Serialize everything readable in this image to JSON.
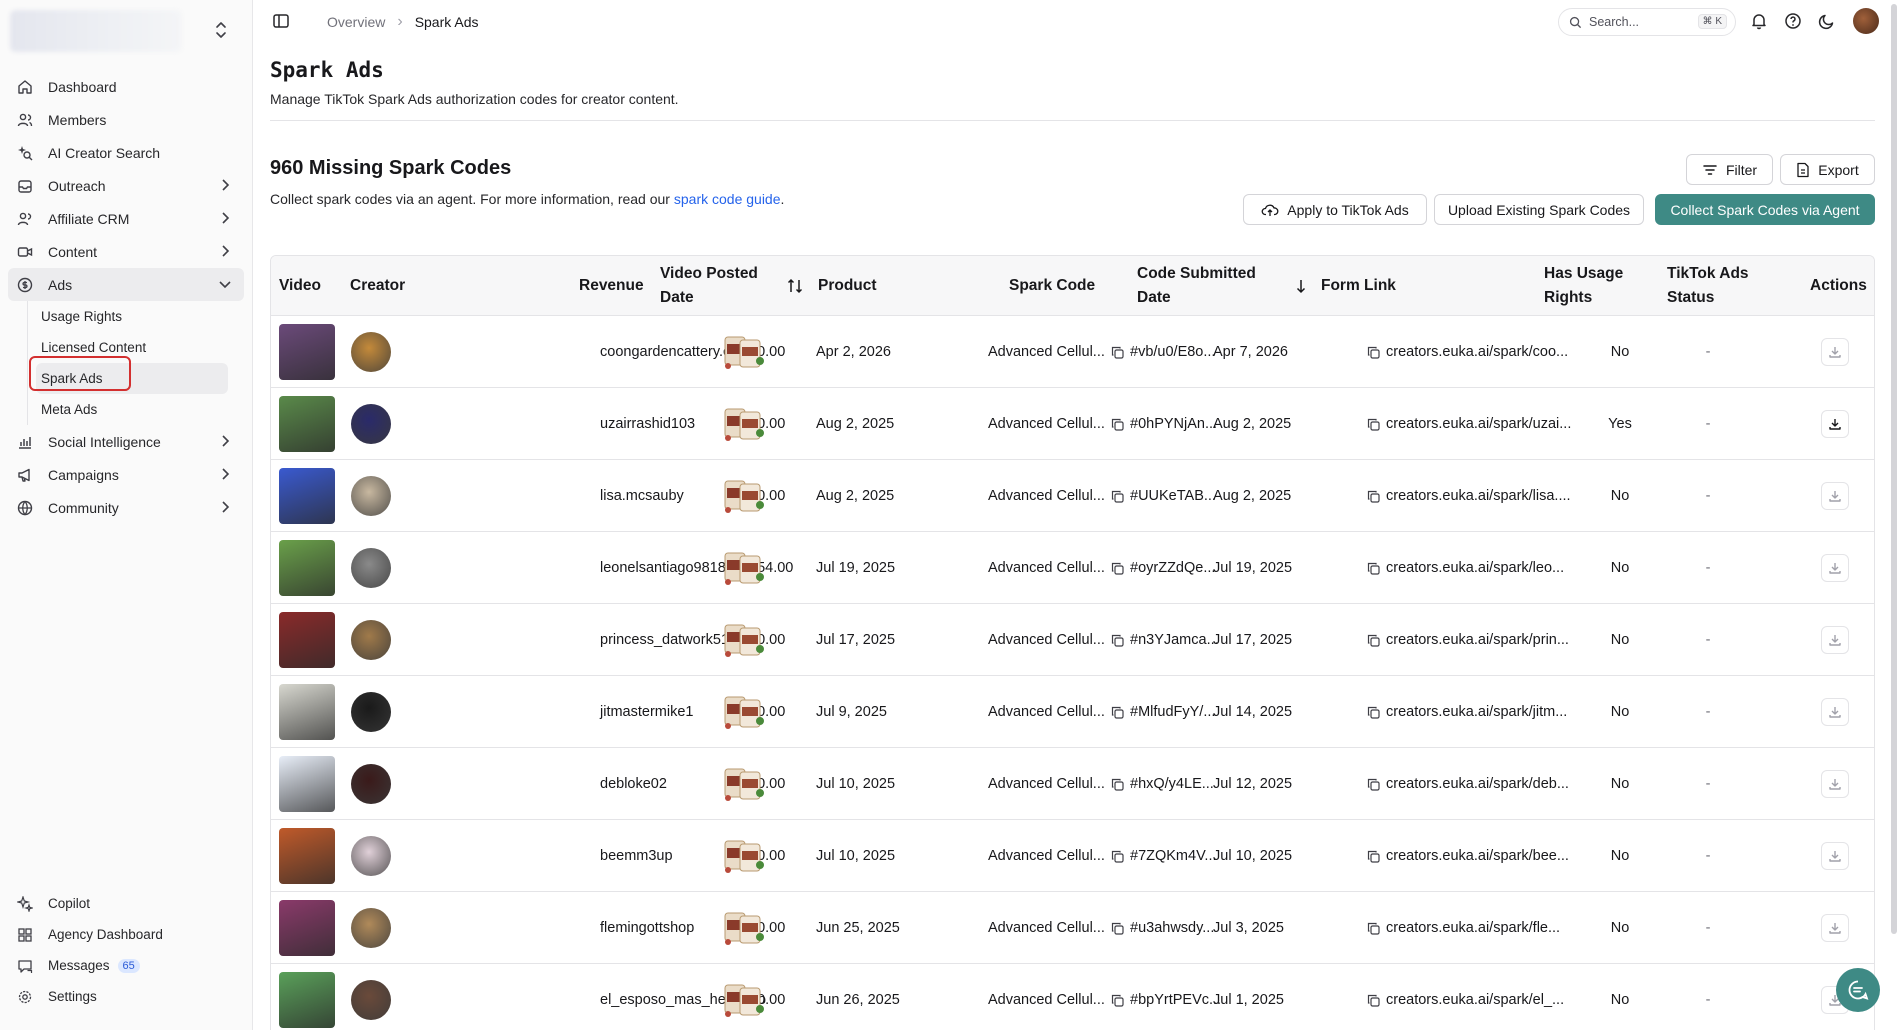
{
  "sidebar": {
    "nav": [
      {
        "label": "Dashboard",
        "icon": "home-icon"
      },
      {
        "label": "Members",
        "icon": "users-icon"
      },
      {
        "label": "AI Creator Search",
        "icon": "sparkle-search-icon"
      },
      {
        "label": "Outreach",
        "icon": "inbox-icon"
      },
      {
        "label": "Affiliate CRM",
        "icon": "users-icon"
      },
      {
        "label": "Content",
        "icon": "video-icon"
      },
      {
        "label": "Ads",
        "icon": "dollar-icon"
      }
    ],
    "ads_sub": [
      "Usage Rights",
      "Licensed Content",
      "Spark Ads",
      "Meta Ads"
    ],
    "nav_more": [
      "Social Intelligence",
      "Campaigns",
      "Community"
    ],
    "bottom": [
      "Copilot",
      "Agency Dashboard",
      "Messages",
      "Settings"
    ],
    "messages_badge": "65"
  },
  "topbar": {
    "crumb_parent": "Overview",
    "crumb_current": "Spark Ads",
    "search_placeholder": "Search...",
    "search_shortcut": "⌘ K"
  },
  "page": {
    "title": "Spark Ads",
    "subtitle": "Manage TikTok Spark Ads authorization codes for creator content.",
    "section_title": "960 Missing Spark Codes",
    "section_sub_prefix": "Collect spark codes via an agent. For more information, read our ",
    "section_sub_link": "spark code guide",
    "section_sub_suffix": ".",
    "buttons": {
      "filter": "Filter",
      "export": "Export",
      "apply": "Apply to TikTok Ads",
      "upload": "Upload Existing Spark Codes",
      "collect": "Collect Spark Codes via Agent"
    }
  },
  "table": {
    "headers": {
      "video": "Video",
      "creator": "Creator",
      "revenue": "Revenue",
      "posted_1": "Video Posted",
      "posted_2": "Date",
      "product": "Product",
      "spark": "Spark Code",
      "submitted_1": "Code Submitted",
      "submitted_2": "Date",
      "form": "Form Link",
      "usage_1": "Has Usage",
      "usage_2": "Rights",
      "status_1": "TikTok Ads",
      "status_2": "Status",
      "actions": "Actions"
    },
    "rows": [
      {
        "creator": "coongardencattery.com",
        "revenue": "$0.00",
        "posted": "Apr 2, 2026",
        "product": "Advanced Cellul...",
        "spark": "#vb/u0/E8o...",
        "submitted": "Apr 7, 2026",
        "form": "creators.euka.ai/spark/coo...",
        "usage": "No",
        "status": "-",
        "thumb": "#6b4a7a",
        "av": "#c48a3a"
      },
      {
        "creator": "uzairrashid103",
        "revenue": "$0.00",
        "posted": "Aug 2, 2025",
        "product": "Advanced Cellul...",
        "spark": "#0hPYNjAn...",
        "submitted": "Aug 2, 2025",
        "form": "creators.euka.ai/spark/uzai...",
        "usage": "Yes",
        "status": "-",
        "thumb": "#5a8a4a",
        "av": "#2a2a6a"
      },
      {
        "creator": "lisa.mcsauby",
        "revenue": "$0.00",
        "posted": "Aug 2, 2025",
        "product": "Advanced Cellul...",
        "spark": "#UUKeTAB...",
        "submitted": "Aug 2, 2025",
        "form": "creators.euka.ai/spark/lisa....",
        "usage": "No",
        "status": "-",
        "thumb": "#3a5ad0",
        "av": "#c8b8a0"
      },
      {
        "creator": "leonelsantiago9818",
        "revenue": "$54.00",
        "posted": "Jul 19, 2025",
        "product": "Advanced Cellul...",
        "spark": "#oyrZZdQe...",
        "submitted": "Jul 19, 2025",
        "form": "creators.euka.ai/spark/leo...",
        "usage": "No",
        "status": "-",
        "thumb": "#6aa04a",
        "av": "#8a8a8a"
      },
      {
        "creator": "princess_datwork513",
        "revenue": "$0.00",
        "posted": "Jul 17, 2025",
        "product": "Advanced Cellul...",
        "spark": "#n3YJamca...",
        "submitted": "Jul 17, 2025",
        "form": "creators.euka.ai/spark/prin...",
        "usage": "No",
        "status": "-",
        "thumb": "#8a2a2a",
        "av": "#a07a4a"
      },
      {
        "creator": "jitmastermike1",
        "revenue": "$0.00",
        "posted": "Jul 9, 2025",
        "product": "Advanced Cellul...",
        "spark": "#MlfudFyY/...",
        "submitted": "Jul 14, 2025",
        "form": "creators.euka.ai/spark/jitm...",
        "usage": "No",
        "status": "-",
        "thumb": "#d8d8d0",
        "av": "#1a1a1a"
      },
      {
        "creator": "debloke02",
        "revenue": "$0.00",
        "posted": "Jul 10, 2025",
        "product": "Advanced Cellul...",
        "spark": "#hxQ/y4LE...",
        "submitted": "Jul 12, 2025",
        "form": "creators.euka.ai/spark/deb...",
        "usage": "No",
        "status": "-",
        "thumb": "#e8eef8",
        "av": "#3a1a1a"
      },
      {
        "creator": "beemm3up",
        "revenue": "$0.00",
        "posted": "Jul 10, 2025",
        "product": "Advanced Cellul...",
        "spark": "#7ZQKm4V...",
        "submitted": "Jul 10, 2025",
        "form": "creators.euka.ai/spark/bee...",
        "usage": "No",
        "status": "-",
        "thumb": "#c05a2a",
        "av": "#e0d0d8"
      },
      {
        "creator": "flemingottshop",
        "revenue": "$0.00",
        "posted": "Jun 25, 2025",
        "product": "Advanced Cellul...",
        "spark": "#u3ahwsdy...",
        "submitted": "Jul 3, 2025",
        "form": "creators.euka.ai/spark/fle...",
        "usage": "No",
        "status": "-",
        "thumb": "#8a3a6a",
        "av": "#b08a5a"
      },
      {
        "creator": "el_esposo_mas_hermoso",
        "revenue": "$0.00",
        "posted": "Jun 26, 2025",
        "product": "Advanced Cellul...",
        "spark": "#bpYrtPEVc...",
        "submitted": "Jul 1, 2025",
        "form": "creators.euka.ai/spark/el_...",
        "usage": "No",
        "status": "-",
        "thumb": "#5aa05a",
        "av": "#6a4a3a"
      }
    ]
  },
  "colors": {
    "accent": "#3e8a85",
    "link": "#2563eb",
    "highlight": "#d32f2f"
  }
}
